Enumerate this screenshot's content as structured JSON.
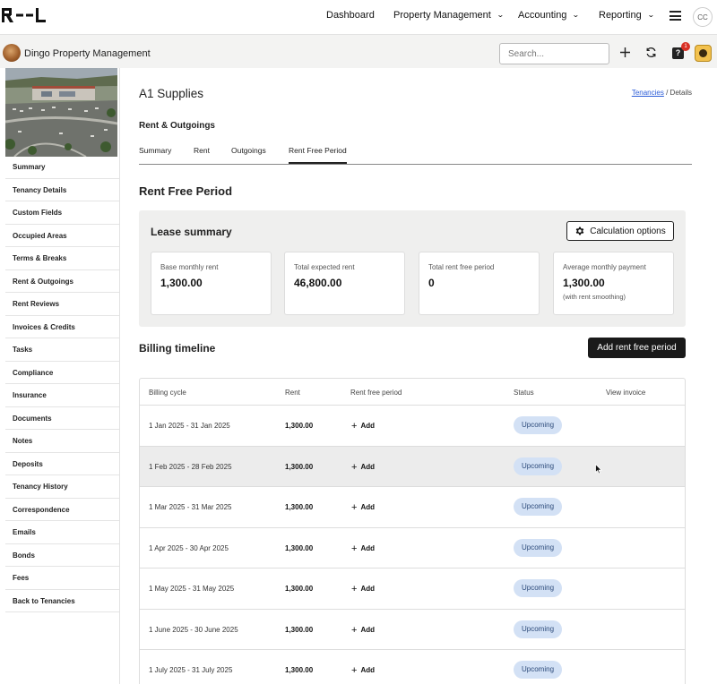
{
  "topnav": {
    "logo_alt": "R--L",
    "links": [
      {
        "label": "Dashboard",
        "has_dropdown": false
      },
      {
        "label": "Property Management",
        "has_dropdown": true
      },
      {
        "label": "Accounting",
        "has_dropdown": true
      },
      {
        "label": "Reporting",
        "has_dropdown": true
      }
    ],
    "user_initials": "CC",
    "chevron": "⌄"
  },
  "subheader": {
    "org_name": "Dingo Property Management",
    "search_placeholder": "Search...",
    "notification_count": "1",
    "icons": [
      "plus-icon",
      "refresh-icon",
      "help-icon",
      "org-badge-icon"
    ]
  },
  "sidebar": {
    "items": [
      "Summary",
      "Tenancy Details",
      "Custom Fields",
      "Occupied Areas",
      "Terms & Breaks",
      "Rent & Outgoings",
      "Rent Reviews",
      "Invoices & Credits",
      "Tasks",
      "Compliance",
      "Insurance",
      "Documents",
      "Notes",
      "Deposits",
      "Tenancy History",
      "Correspondence",
      "Emails",
      "Bonds",
      "Fees",
      "Back to Tenancies"
    ]
  },
  "main": {
    "title": "A1 Supplies",
    "breadcrumb": {
      "link": "Tenancies",
      "separator": "/",
      "current": "Details"
    },
    "section_title": "Rent & Outgoings",
    "tabs": [
      "Summary",
      "Rent",
      "Outgoings",
      "Rent Free Period"
    ],
    "active_tab": "Rent Free Period",
    "rfp_title": "Rent Free Period",
    "lease_summary": {
      "title": "Lease summary",
      "calc_button": "Calculation options",
      "cards": [
        {
          "label": "Base monthly rent",
          "value": "1,300.00",
          "note": ""
        },
        {
          "label": "Total expected rent",
          "value": "46,800.00",
          "note": ""
        },
        {
          "label": "Total rent free period",
          "value": "0",
          "note": ""
        },
        {
          "label": "Average monthly payment",
          "value": "1,300.00",
          "note": "(with rent smoothing)"
        }
      ]
    },
    "billing": {
      "title": "Billing timeline",
      "add_button": "Add rent free period",
      "columns": [
        "Billing cycle",
        "Rent",
        "Rent free period",
        "Status",
        "View invoice"
      ],
      "add_label": "Add",
      "rows": [
        {
          "cycle": "1 Jan 2025 - 31 Jan 2025",
          "rent": "1,300.00",
          "status": "Upcoming"
        },
        {
          "cycle": "1 Feb 2025 - 28 Feb 2025",
          "rent": "1,300.00",
          "status": "Upcoming"
        },
        {
          "cycle": "1 Mar 2025 - 31 Mar 2025",
          "rent": "1,300.00",
          "status": "Upcoming"
        },
        {
          "cycle": "1 Apr 2025 - 30 Apr 2025",
          "rent": "1,300.00",
          "status": "Upcoming"
        },
        {
          "cycle": "1 May 2025 - 31 May 2025",
          "rent": "1,300.00",
          "status": "Upcoming"
        },
        {
          "cycle": "1 June 2025 - 30 June 2025",
          "rent": "1,300.00",
          "status": "Upcoming"
        },
        {
          "cycle": "1 July 2025 - 31 July 2025",
          "rent": "1,300.00",
          "status": "Upcoming"
        }
      ]
    }
  },
  "colors": {
    "accent_dark": "#1a1a1a",
    "badge_bg": "#d3e1f5",
    "badge_text": "#2c4a7a",
    "link": "#2a5bd7",
    "notification": "#d93025"
  }
}
